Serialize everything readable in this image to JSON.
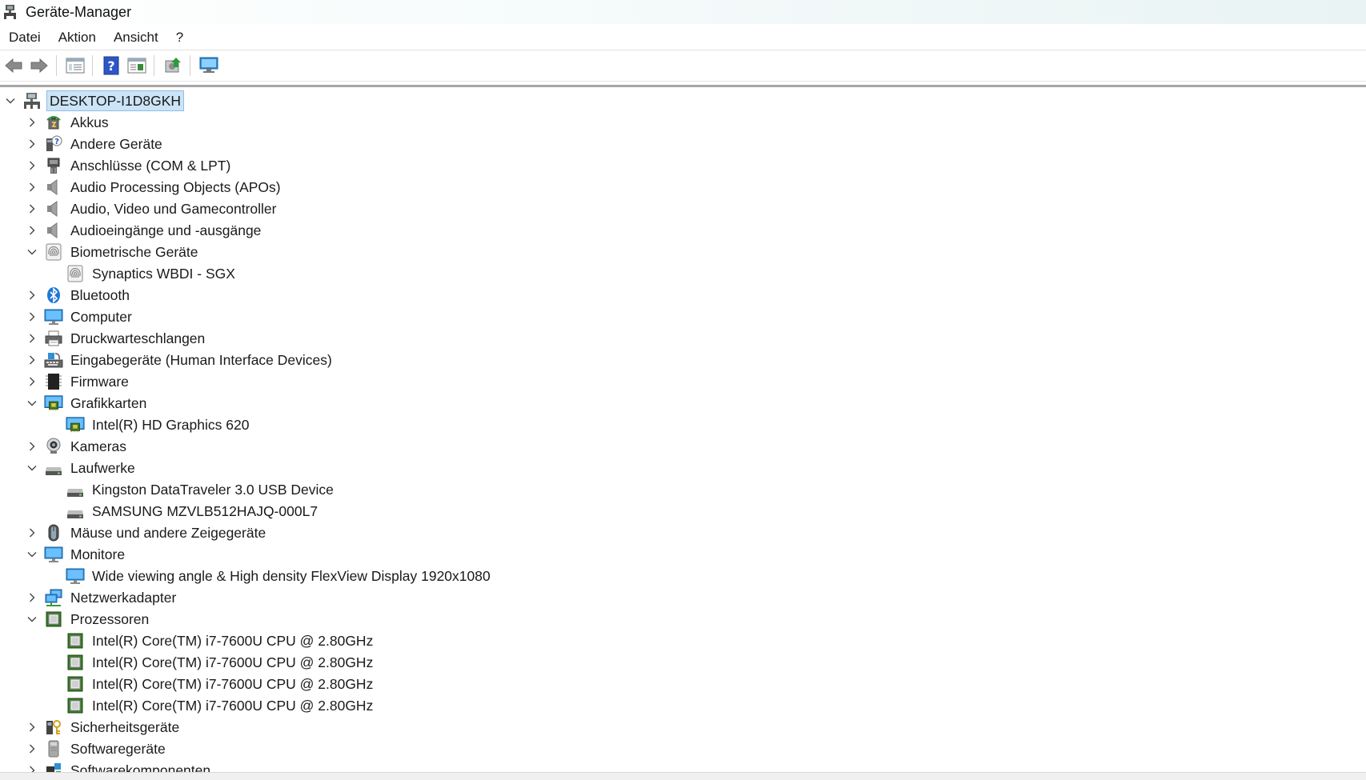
{
  "window": {
    "title": "Geräte-Manager"
  },
  "menu": [
    "Datei",
    "Aktion",
    "Ansicht",
    "?"
  ],
  "toolbar": [
    {
      "name": "back-icon"
    },
    {
      "name": "forward-icon"
    },
    {
      "sep": true
    },
    {
      "name": "properties-icon"
    },
    {
      "sep": true
    },
    {
      "name": "help-icon"
    },
    {
      "name": "view-icon"
    },
    {
      "sep": true
    },
    {
      "name": "update-driver-icon"
    },
    {
      "sep": true
    },
    {
      "name": "scan-hardware-icon"
    }
  ],
  "tree": {
    "root": "DESKTOP-I1D8GKH",
    "rows": [
      {
        "level": 1,
        "label": "Akkus",
        "expanded": false,
        "icon": "battery-icon"
      },
      {
        "level": 1,
        "label": "Andere Geräte",
        "expanded": false,
        "icon": "unknown-device-icon"
      },
      {
        "level": 1,
        "label": "Anschlüsse (COM & LPT)",
        "expanded": false,
        "icon": "port-icon"
      },
      {
        "level": 1,
        "label": "Audio Processing Objects (APOs)",
        "expanded": false,
        "icon": "speaker-icon"
      },
      {
        "level": 1,
        "label": "Audio, Video und Gamecontroller",
        "expanded": false,
        "icon": "speaker-icon"
      },
      {
        "level": 1,
        "label": "Audioeingänge und -ausgänge",
        "expanded": false,
        "icon": "speaker-icon"
      },
      {
        "level": 1,
        "label": "Biometrische Geräte",
        "expanded": true,
        "icon": "fingerprint-icon"
      },
      {
        "level": 2,
        "label": "Synaptics WBDI - SGX",
        "icon": "fingerprint-icon"
      },
      {
        "level": 1,
        "label": "Bluetooth",
        "expanded": false,
        "icon": "bluetooth-icon"
      },
      {
        "level": 1,
        "label": "Computer",
        "expanded": false,
        "icon": "monitor-icon"
      },
      {
        "level": 1,
        "label": "Druckwarteschlangen",
        "expanded": false,
        "icon": "printer-icon"
      },
      {
        "level": 1,
        "label": "Eingabegeräte (Human Interface Devices)",
        "expanded": false,
        "icon": "hid-icon"
      },
      {
        "level": 1,
        "label": "Firmware",
        "expanded": false,
        "icon": "firmware-icon"
      },
      {
        "level": 1,
        "label": "Grafikkarten",
        "expanded": true,
        "icon": "display-adapter-icon"
      },
      {
        "level": 2,
        "label": "Intel(R) HD Graphics 620",
        "icon": "display-adapter-icon"
      },
      {
        "level": 1,
        "label": "Kameras",
        "expanded": false,
        "icon": "webcam-icon"
      },
      {
        "level": 1,
        "label": "Laufwerke",
        "expanded": true,
        "icon": "drive-icon"
      },
      {
        "level": 2,
        "label": "Kingston DataTraveler 3.0 USB Device",
        "icon": "drive-icon"
      },
      {
        "level": 2,
        "label": "SAMSUNG MZVLB512HAJQ-000L7",
        "icon": "drive-icon"
      },
      {
        "level": 1,
        "label": "Mäuse und andere Zeigegeräte",
        "expanded": false,
        "icon": "mouse-icon"
      },
      {
        "level": 1,
        "label": "Monitore",
        "expanded": true,
        "icon": "monitor-icon"
      },
      {
        "level": 2,
        "label": "Wide viewing angle & High density FlexView Display 1920x1080",
        "icon": "monitor-icon"
      },
      {
        "level": 1,
        "label": "Netzwerkadapter",
        "expanded": false,
        "icon": "network-icon"
      },
      {
        "level": 1,
        "label": "Prozessoren",
        "expanded": true,
        "icon": "cpu-icon"
      },
      {
        "level": 2,
        "label": "Intel(R) Core(TM) i7-7600U CPU @ 2.80GHz",
        "icon": "cpu-icon"
      },
      {
        "level": 2,
        "label": "Intel(R) Core(TM) i7-7600U CPU @ 2.80GHz",
        "icon": "cpu-icon"
      },
      {
        "level": 2,
        "label": "Intel(R) Core(TM) i7-7600U CPU @ 2.80GHz",
        "icon": "cpu-icon"
      },
      {
        "level": 2,
        "label": "Intel(R) Core(TM) i7-7600U CPU @ 2.80GHz",
        "icon": "cpu-icon"
      },
      {
        "level": 1,
        "label": "Sicherheitsgeräte",
        "expanded": false,
        "icon": "security-icon"
      },
      {
        "level": 1,
        "label": "Softwaregeräte",
        "expanded": false,
        "icon": "software-device-icon"
      },
      {
        "level": 1,
        "label": "Softwarekomponenten",
        "expanded": false,
        "icon": "software-component-icon"
      }
    ]
  },
  "colors": {
    "selection_bg": "#cce4f7",
    "selection_border": "#8fbde6",
    "monitor_blue": "#2f8fd8",
    "cpu_green": "#3a7a2a"
  }
}
